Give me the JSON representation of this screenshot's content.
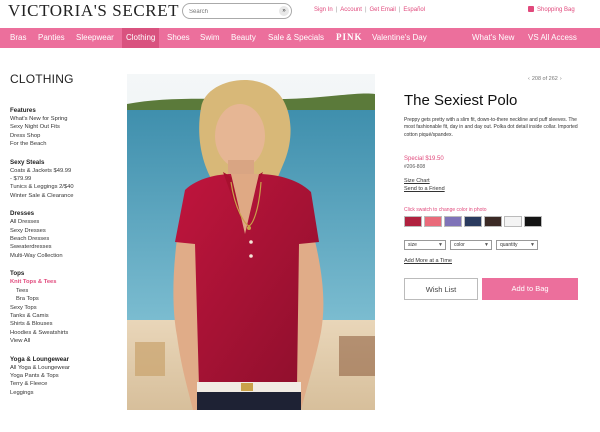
{
  "header": {
    "logo": "VICTORIA'S SECRET",
    "search_placeholder": "Search",
    "search_go": "»",
    "top_links": [
      "Sign In",
      "Account",
      "Get Email",
      "Español"
    ],
    "shopping_bag": "Shopping Bag"
  },
  "nav": {
    "items": [
      "Bras",
      "Panties",
      "Sleepwear",
      "Clothing",
      "Shoes",
      "Swim",
      "Beauty",
      "Sale & Specials",
      "PINK",
      "Valentine's Day",
      "What's New",
      "VS All Access"
    ],
    "active": "Clothing"
  },
  "sidebar": {
    "title": "CLOTHING",
    "groups": [
      {
        "head": "Features",
        "items": [
          "What's New for Spring",
          "Sexy Night Out Fits",
          "Dress Shop",
          "For the Beach"
        ]
      },
      {
        "head": "Sexy Steals",
        "items": [
          "Coats & Jackets $49.99 - $79.99",
          "Tunics & Leggings 2/$40",
          "Winter Sale & Clearance"
        ]
      },
      {
        "head": "Dresses",
        "items": [
          "All Dresses",
          "Sexy Dresses",
          "Beach Dresses",
          "Sweaterdresses",
          "Multi-Way Collection"
        ]
      },
      {
        "head": "Tops",
        "items": [
          "Knit Tops & Tees",
          "Tees",
          "Bra Tops",
          "Sexy Tops",
          "Tanks & Camis",
          "Shirts & Blouses",
          "Hoodies & Sweatshirts",
          "View All"
        ]
      },
      {
        "head": "Yoga & Loungewear",
        "items": [
          "All Yoga & Loungewear",
          "Yoga Pants & Tops",
          "Terry & Fleece",
          "Leggings"
        ]
      }
    ],
    "active_item": "Knit Tops & Tees",
    "sub_items": [
      "Tees",
      "Bra Tops"
    ]
  },
  "product": {
    "pager": {
      "prev": "‹",
      "next": "›",
      "text": "208 of 262"
    },
    "title": "The Sexiest Polo",
    "description": "Preppy gets pretty with a slim fit, down-to-there neckline and puff sleeves. The most fashionable fit, day in and day out. Polka dot detail inside collar. Imported cotton piqué/spandex.",
    "price": "Special $19.50",
    "sku": "#206-808",
    "size_chart": "Size Chart",
    "send_friend": "Send to a Friend",
    "swatch_hint": "Click swatch to change color in photo",
    "swatches": [
      "#b0213f",
      "#e96a7a",
      "#7f73b8",
      "#2a3a5e",
      "#3b2a25",
      "#f4f4f4",
      "#141414"
    ],
    "selects": [
      "size",
      "color",
      "quantity"
    ],
    "add_more": "Add More at a Time",
    "wish_list": "Wish List",
    "add_to_bag": "Add to Bag"
  },
  "colors": {
    "brand_pink": "#ec6f9c",
    "link_pink": "#e1497c",
    "nav_active": "#d9527f"
  }
}
